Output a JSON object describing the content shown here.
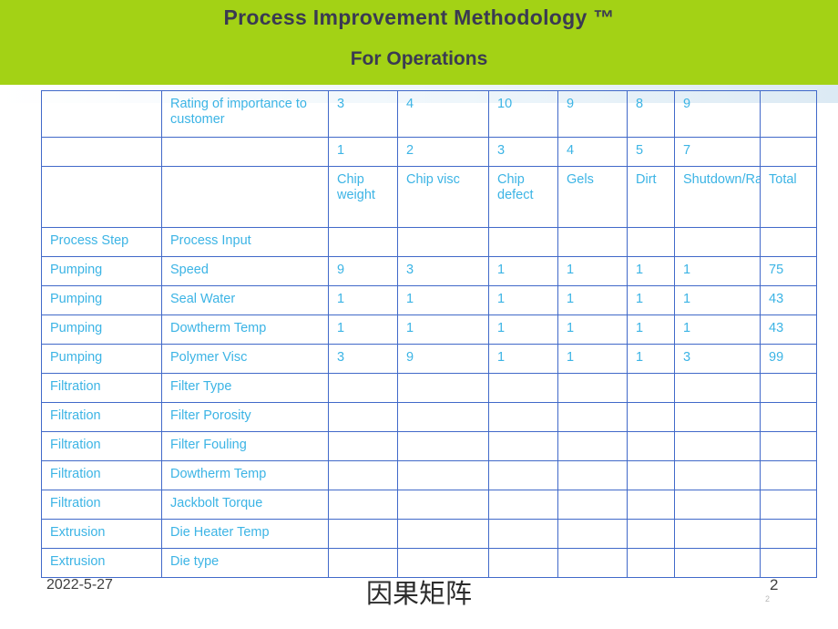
{
  "header": {
    "title_line1": "Process Improvement Methodology ™",
    "title_line2": "For Operations"
  },
  "table": {
    "rating_row": {
      "label": "",
      "input_label": "Rating of importance to customer",
      "values": [
        "3",
        "4",
        "10",
        "9",
        "8",
        "9",
        ""
      ]
    },
    "index_row": {
      "label": "",
      "input_label": "",
      "values": [
        "1",
        "2",
        "3",
        "4",
        "5",
        "7",
        ""
      ]
    },
    "names_row": {
      "label": "",
      "input_label": "",
      "values": [
        "Chip weight",
        "Chip visc",
        "Chip defect",
        "Gels",
        "Dirt",
        "Shutdown/Rate",
        "Total"
      ]
    },
    "column_header_row": {
      "label": "Process Step",
      "input_label": "Process Input",
      "values": [
        "",
        "",
        "",
        "",
        "",
        "",
        ""
      ]
    },
    "rows": [
      {
        "step": "Pumping",
        "input": "Speed",
        "values": [
          "9",
          "3",
          "1",
          "1",
          "1",
          "1",
          "75"
        ]
      },
      {
        "step": "Pumping",
        "input": "Seal Water",
        "values": [
          "1",
          "1",
          "1",
          "1",
          "1",
          "1",
          "43"
        ]
      },
      {
        "step": "Pumping",
        "input": "Dowtherm Temp",
        "values": [
          "1",
          "1",
          "1",
          "1",
          "1",
          "1",
          "43"
        ]
      },
      {
        "step": "Pumping",
        "input": "Polymer Visc",
        "values": [
          "3",
          "9",
          "1",
          "1",
          "1",
          "3",
          "99"
        ]
      },
      {
        "step": "Filtration",
        "input": "Filter Type",
        "values": [
          "",
          "",
          "",
          "",
          "",
          "",
          ""
        ]
      },
      {
        "step": "Filtration",
        "input": "Filter Porosity",
        "values": [
          "",
          "",
          "",
          "",
          "",
          "",
          ""
        ]
      },
      {
        "step": "Filtration",
        "input": "Filter Fouling",
        "values": [
          "",
          "",
          "",
          "",
          "",
          "",
          ""
        ]
      },
      {
        "step": "Filtration",
        "input": "Dowtherm Temp",
        "values": [
          "",
          "",
          "",
          "",
          "",
          "",
          ""
        ]
      },
      {
        "step": "Filtration",
        "input": "Jackbolt Torque",
        "values": [
          "",
          "",
          "",
          "",
          "",
          "",
          ""
        ]
      },
      {
        "step": "Extrusion",
        "input": "Die Heater Temp",
        "values": [
          "",
          "",
          "",
          "",
          "",
          "",
          ""
        ]
      },
      {
        "step": "Extrusion",
        "input": "Die type",
        "values": [
          "",
          "",
          "",
          "",
          "",
          "",
          ""
        ]
      }
    ]
  },
  "footer": {
    "date": "2022-5-27",
    "center_title": "因果矩阵",
    "center_sub": " ",
    "page_number": "2",
    "page_number_small": "2",
    "ghost": " "
  }
}
